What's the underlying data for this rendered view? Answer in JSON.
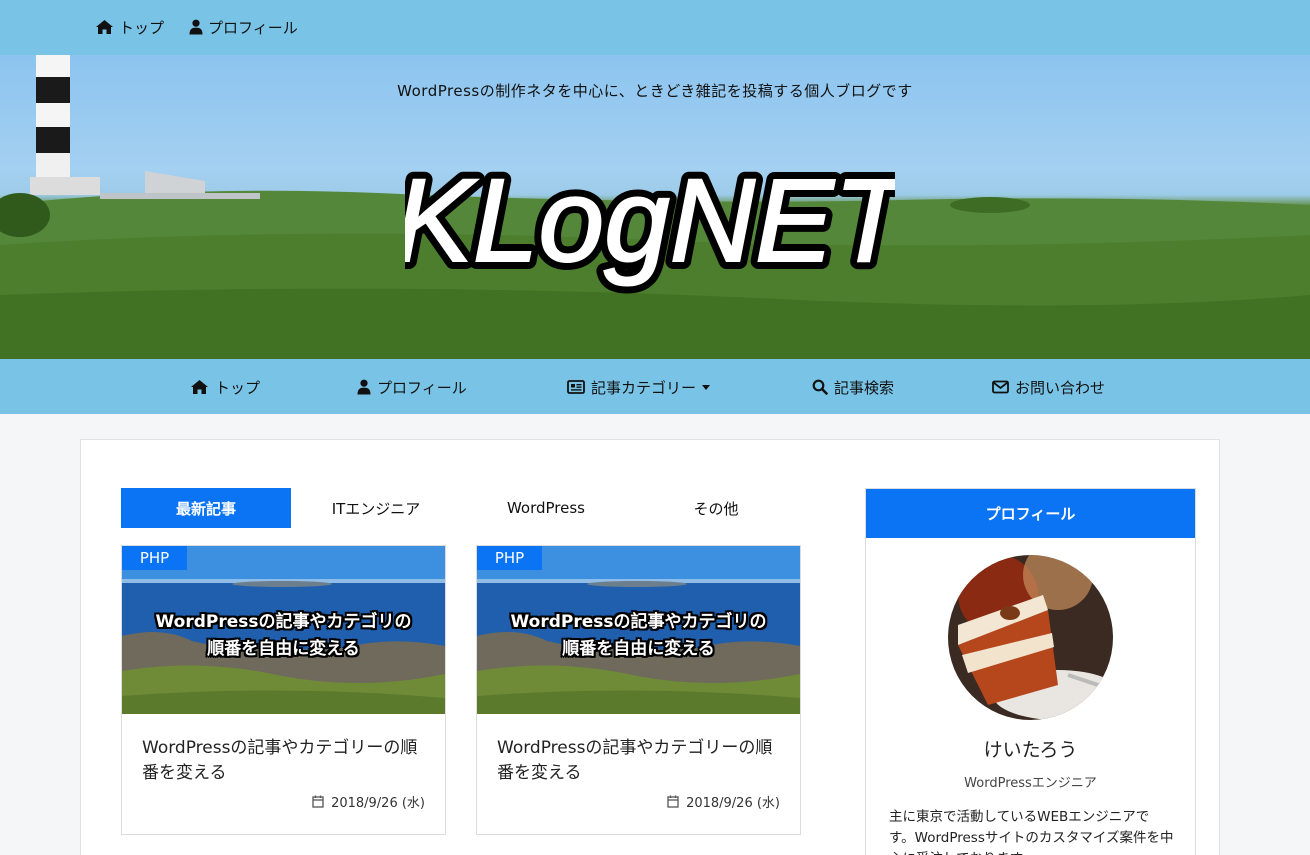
{
  "topbar": {
    "items": [
      {
        "label": "トップ",
        "icon": "home-icon"
      },
      {
        "label": "プロフィール",
        "icon": "user-icon"
      }
    ]
  },
  "hero": {
    "tagline": "WordPressの制作ネタを中心に、ときどき雑記を投稿する個人ブログです",
    "logo_text": "KLogNET"
  },
  "nav": {
    "items": [
      {
        "label": "トップ",
        "icon": "home-icon"
      },
      {
        "label": "プロフィール",
        "icon": "user-icon"
      },
      {
        "label": "記事カテゴリー",
        "icon": "newspaper-icon",
        "dropdown": true
      },
      {
        "label": "記事検索",
        "icon": "search-icon"
      },
      {
        "label": "お問い合わせ",
        "icon": "envelope-icon"
      }
    ]
  },
  "tabs": [
    {
      "label": "最新記事",
      "active": true
    },
    {
      "label": "ITエンジニア",
      "active": false
    },
    {
      "label": "WordPress",
      "active": false
    },
    {
      "label": "その他",
      "active": false
    }
  ],
  "cards": [
    {
      "badge": "PHP",
      "thumb_line1": "WordPressの記事やカテゴリの",
      "thumb_line2": "順番を自由に変える",
      "title": "WordPressの記事やカテゴリーの順番を変える",
      "date": "2018/9/26 (水)"
    },
    {
      "badge": "PHP",
      "thumb_line1": "WordPressの記事やカテゴリの",
      "thumb_line2": "順番を自由に変える",
      "title": "WordPressの記事やカテゴリーの順番を変える",
      "date": "2018/9/26 (水)"
    }
  ],
  "profile": {
    "heading": "プロフィール",
    "name": "けいたろう",
    "role": "WordPressエンジニア",
    "bio": "主に東京で活動しているWEBエンジニアです。WordPressサイトのカスタマイズ案件を中心に受注しております。"
  },
  "colors": {
    "bar": "#79c4e6",
    "accent": "#0a74f5"
  }
}
